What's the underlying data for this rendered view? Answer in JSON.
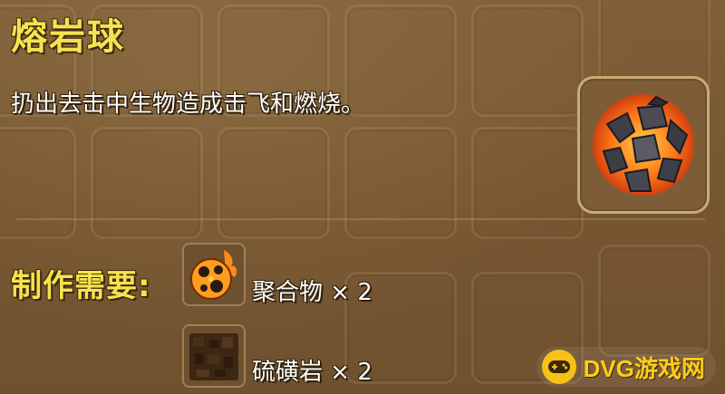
{
  "item": {
    "name": "熔岩球",
    "description": "扔出去击中生物造成击飞和燃烧。",
    "icon": "lava-ball-icon"
  },
  "recipe": {
    "label": "制作需要:",
    "materials": [
      {
        "name": "聚合物",
        "quantity": "× 2",
        "icon": "polymer-fire-ball-icon"
      },
      {
        "name": "硫磺岩",
        "quantity": "× 2",
        "icon": "sulfur-rock-block-icon"
      }
    ]
  },
  "watermark": {
    "text": "DVG游戏网"
  },
  "colors": {
    "title_yellow": "#f6e24d",
    "background_brown": "#7a5a33",
    "lava_orange": "#ff7a1a"
  }
}
